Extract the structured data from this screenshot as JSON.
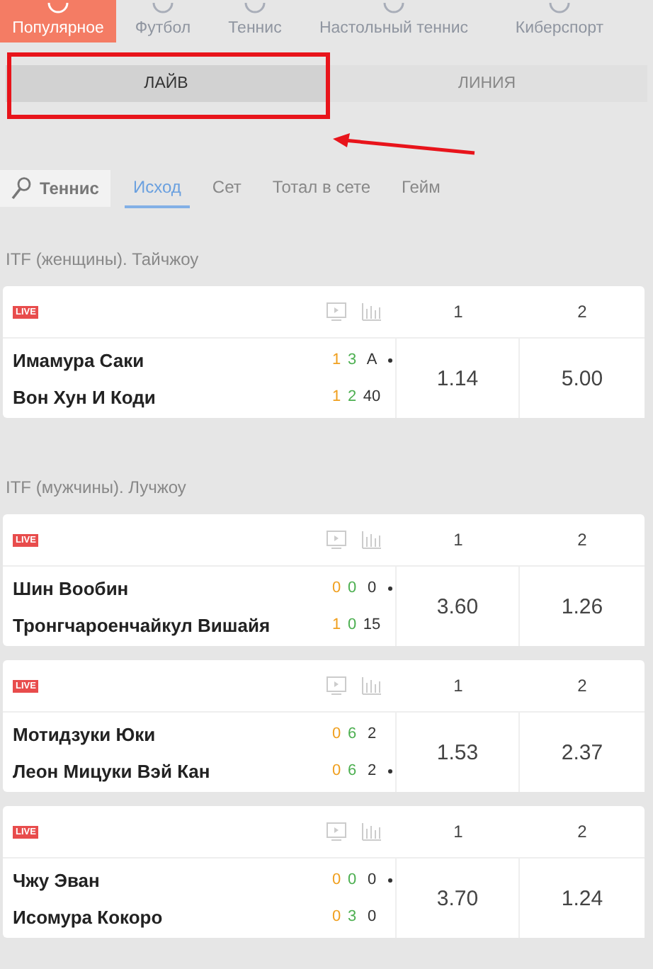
{
  "nav": [
    {
      "label": "Популярное",
      "selected": true
    },
    {
      "label": "Футбол",
      "selected": false
    },
    {
      "label": "Теннис",
      "selected": false
    },
    {
      "label": "Настольный теннис",
      "selected": false
    },
    {
      "label": "Киберспорт",
      "selected": false
    }
  ],
  "mode_tabs": [
    {
      "label": "ЛАЙВ",
      "selected": true
    },
    {
      "label": "ЛИНИЯ",
      "selected": false
    }
  ],
  "sport_chip": {
    "label": "Теннис"
  },
  "market_tabs": [
    {
      "label": "Исход",
      "selected": true
    },
    {
      "label": "Сет",
      "selected": false
    },
    {
      "label": "Тотал в сете",
      "selected": false
    },
    {
      "label": "Гейм",
      "selected": false
    }
  ],
  "tournaments": [
    {
      "title": "ITF (женщины). Тайчжоу",
      "matches": [
        {
          "badge": "LIVE",
          "col_1": "1",
          "col_2": "2",
          "players": [
            {
              "name": "Имамура Саки",
              "sets": "1",
              "games": "3",
              "points": "A",
              "serving": true
            },
            {
              "name": "Вон Хун И Коди",
              "sets": "1",
              "games": "2",
              "points": "40",
              "serving": false
            }
          ],
          "odds": [
            "1.14",
            "5.00"
          ]
        }
      ]
    },
    {
      "title": "ITF (мужчины). Лучжоу",
      "matches": [
        {
          "badge": "LIVE",
          "col_1": "1",
          "col_2": "2",
          "players": [
            {
              "name": "Шин Вообин",
              "sets": "0",
              "games": "0",
              "points": "0",
              "serving": true
            },
            {
              "name": "Тронгчароенчайкул Вишайя",
              "sets": "1",
              "games": "0",
              "points": "15",
              "serving": false
            }
          ],
          "odds": [
            "3.60",
            "1.26"
          ]
        },
        {
          "badge": "LIVE",
          "col_1": "1",
          "col_2": "2",
          "players": [
            {
              "name": "Мотидзуки Юки",
              "sets": "0",
              "games": "6",
              "points": "2",
              "serving": false
            },
            {
              "name": "Леон Мицуки Вэй Кан",
              "sets": "0",
              "games": "6",
              "points": "2",
              "serving": true
            }
          ],
          "odds": [
            "1.53",
            "2.37"
          ]
        },
        {
          "badge": "LIVE",
          "col_1": "1",
          "col_2": "2",
          "players": [
            {
              "name": "Чжу Эван",
              "sets": "0",
              "games": "0",
              "points": "0",
              "serving": true
            },
            {
              "name": "Исомура Кокоро",
              "sets": "0",
              "games": "3",
              "points": "0",
              "serving": false
            }
          ],
          "odds": [
            "3.70",
            "1.24"
          ]
        }
      ]
    }
  ]
}
